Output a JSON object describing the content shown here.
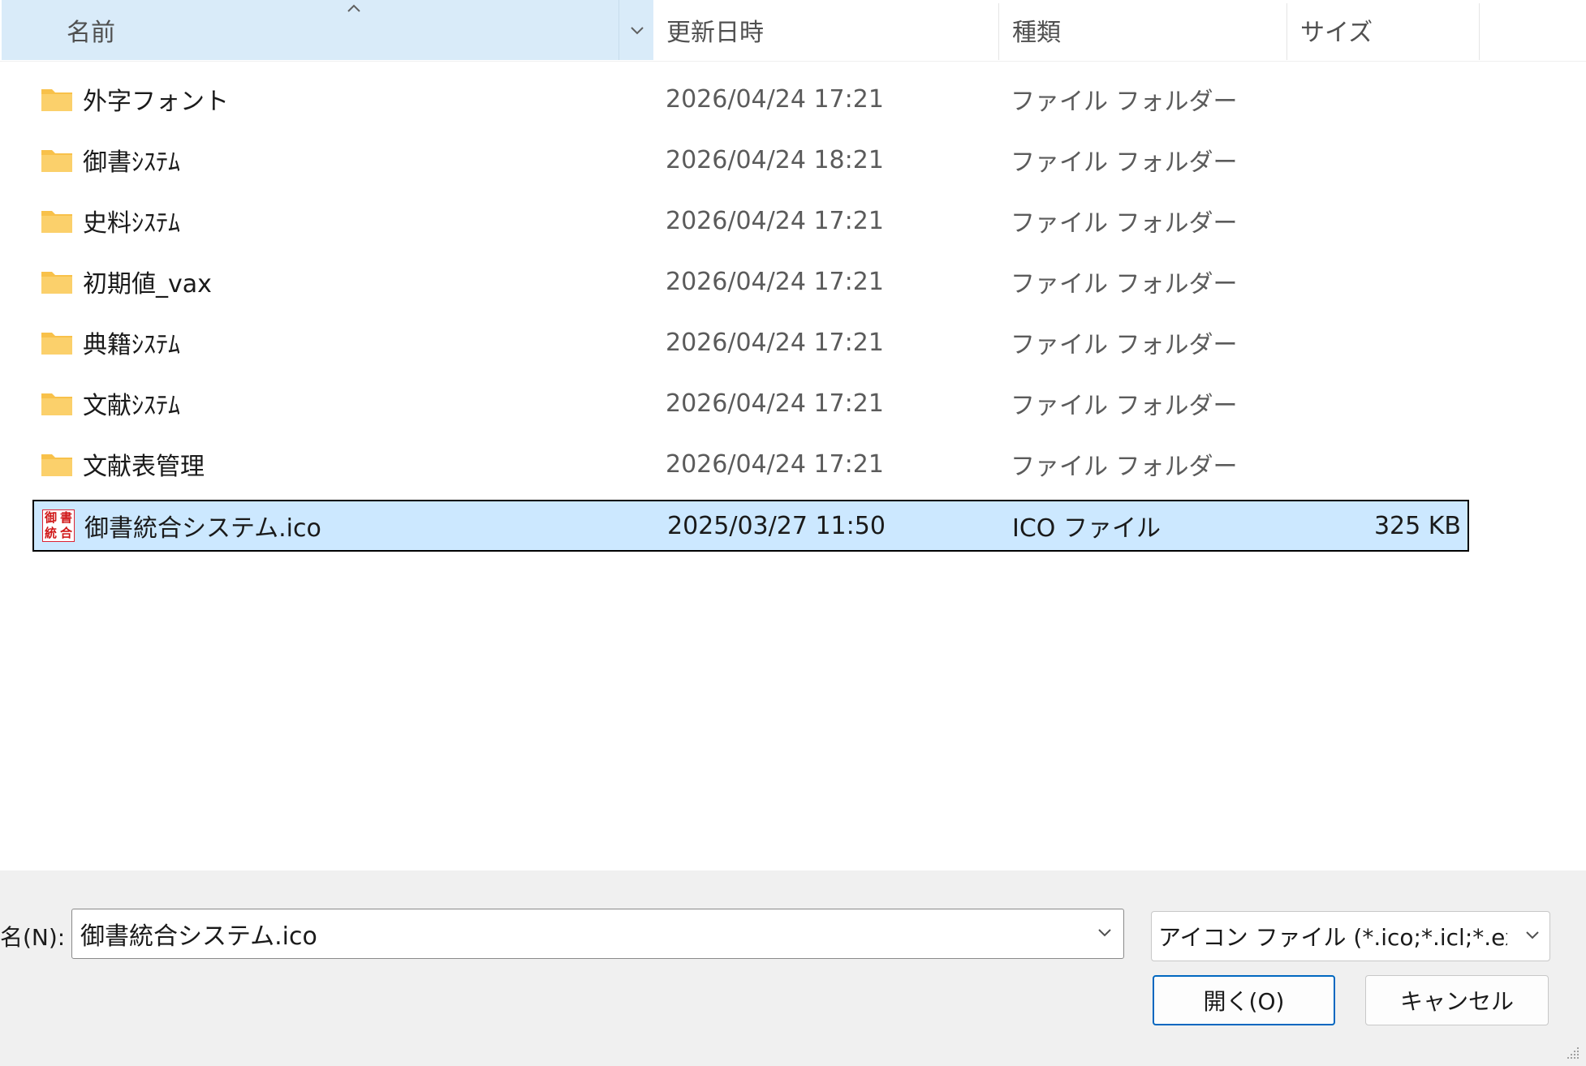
{
  "columns": {
    "name": "名前",
    "date": "更新日時",
    "type": "種類",
    "size": "サイズ"
  },
  "files": [
    {
      "name": "外字フォント",
      "date": "2026/04/24 17:21",
      "type": "ファイル フォルダー",
      "size": "",
      "icon": "folder-icon",
      "selected": false
    },
    {
      "name": "御書ｼｽﾃﾑ",
      "date": "2026/04/24 18:21",
      "type": "ファイル フォルダー",
      "size": "",
      "icon": "folder-icon",
      "selected": false
    },
    {
      "name": "史料ｼｽﾃﾑ",
      "date": "2026/04/24 17:21",
      "type": "ファイル フォルダー",
      "size": "",
      "icon": "folder-icon",
      "selected": false
    },
    {
      "name": "初期値_vax",
      "date": "2026/04/24 17:21",
      "type": "ファイル フォルダー",
      "size": "",
      "icon": "folder-icon",
      "selected": false
    },
    {
      "name": "典籍ｼｽﾃﾑ",
      "date": "2026/04/24 17:21",
      "type": "ファイル フォルダー",
      "size": "",
      "icon": "folder-icon",
      "selected": false
    },
    {
      "name": "文献ｼｽﾃﾑ",
      "date": "2026/04/24 17:21",
      "type": "ファイル フォルダー",
      "size": "",
      "icon": "folder-icon",
      "selected": false
    },
    {
      "name": "文献表管理",
      "date": "2026/04/24 17:21",
      "type": "ファイル フォルダー",
      "size": "",
      "icon": "folder-icon",
      "selected": false
    },
    {
      "name": "御書統合システム.ico",
      "date": "2025/03/27 11:50",
      "type": "ICO ファイル",
      "size": "325 KB",
      "icon": "ico-file-icon",
      "selected": true
    }
  ],
  "ico_badge": [
    "御",
    "書",
    "統",
    "合"
  ],
  "footer": {
    "filename_label": "名(N):",
    "filename_value": "御書統合システム.ico",
    "filetype_value": "アイコン ファイル (*.ico;*.icl;*.exe;*.",
    "open_label": "開く(O)",
    "cancel_label": "キャンセル"
  },
  "colors": {
    "selection": "#cce8ff",
    "header_active": "#d9ebf9",
    "folder": "#f8c14a",
    "accent": "#0067c0"
  }
}
